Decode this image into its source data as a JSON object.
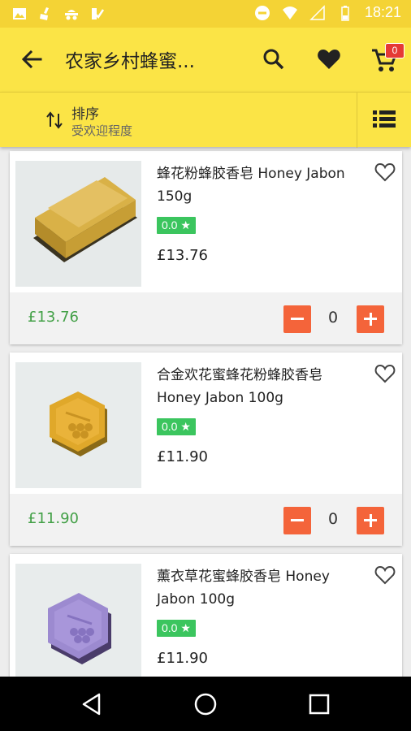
{
  "status_bar": {
    "time": "18:21",
    "left_icons": [
      "image-icon",
      "cleaner-icon",
      "hat-icon",
      "check-icon"
    ],
    "right_icons": [
      "minus-circle-icon",
      "wifi-icon",
      "signal-icon",
      "battery-icon"
    ]
  },
  "app_bar": {
    "title": "农家乡村蜂蜜...",
    "cart_count": "0"
  },
  "sort_bar": {
    "label": "排序",
    "value": "受欢迎程度"
  },
  "products": [
    {
      "name": "蜂花粉蜂胶香皂 Honey Jabon 150g",
      "rating": "0.0 ★",
      "price": "£13.76",
      "subtotal": "£13.76",
      "quantity": "0"
    },
    {
      "name": "合金欢花蜜蜂花粉蜂胶香皂 Honey Jabon 100g",
      "rating": "0.0 ★",
      "price": "£11.90",
      "subtotal": "£11.90",
      "quantity": "0"
    },
    {
      "name": "薰衣草花蜜蜂胶香皂 Honey Jabon 100g",
      "rating": "0.0 ★",
      "price": "£11.90"
    }
  ],
  "colors": {
    "accent": "#fbe446",
    "status_bar": "#f4d335",
    "rating_badge": "#3bc55e",
    "qty_button": "#f4643a",
    "subtotal_text": "#43a047"
  }
}
